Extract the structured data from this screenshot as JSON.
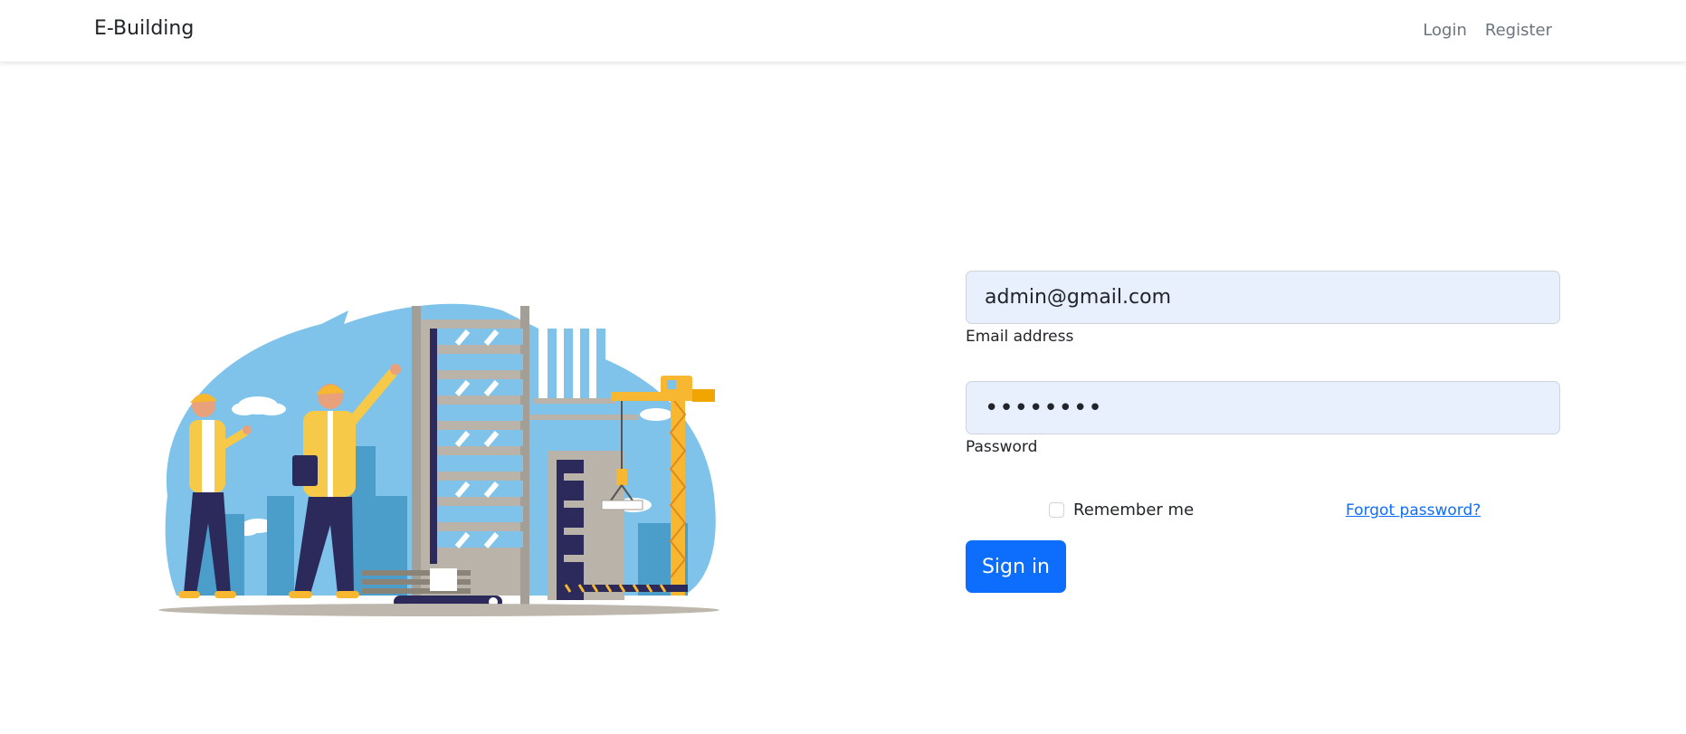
{
  "nav": {
    "brand": "E-Building",
    "links": [
      {
        "label": "Login"
      },
      {
        "label": "Register"
      }
    ]
  },
  "form": {
    "email": {
      "value": "admin@gmail.com",
      "label": "Email address"
    },
    "password": {
      "value": "••••••••",
      "label": "Password"
    },
    "remember_label": "Remember me",
    "forgot_label": "Forgot password?",
    "submit_label": "Sign in"
  },
  "colors": {
    "primary": "#0d6efd",
    "input_bg": "#e8f0fe",
    "sky": "#7fc3ea",
    "helmet": "#f7b731",
    "navy": "#2b2a5a"
  },
  "icons": {
    "illustration": "construction-workers-building-illustration"
  }
}
